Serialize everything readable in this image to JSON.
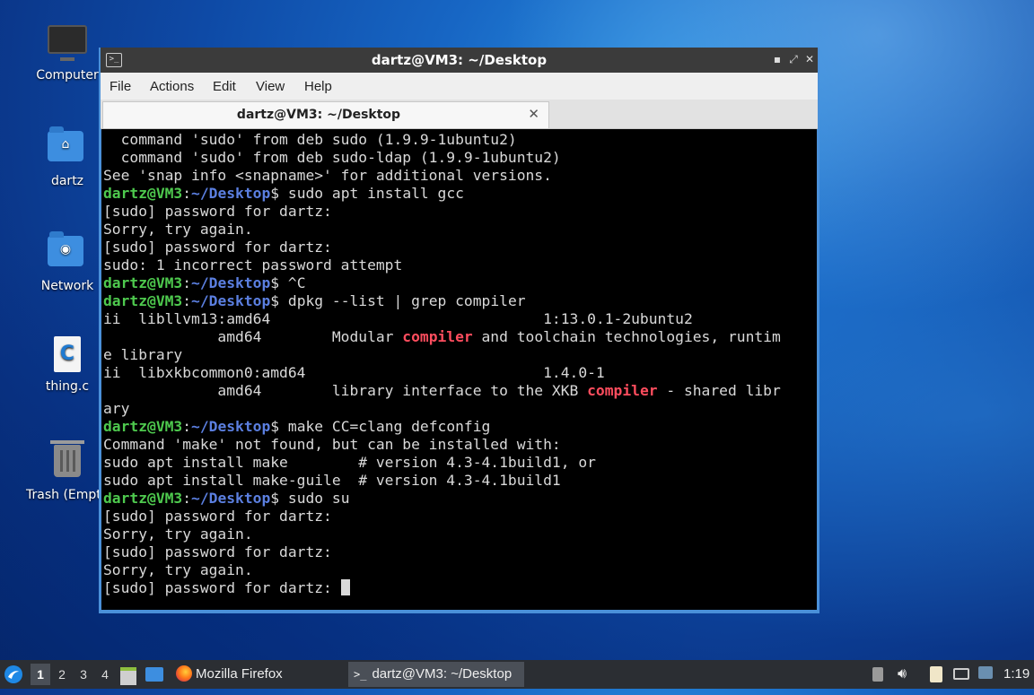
{
  "desktop": {
    "icons": [
      {
        "label": "Computer",
        "icon": "computer-icon"
      },
      {
        "label": "dartz",
        "icon": "home-folder-icon"
      },
      {
        "label": "Network",
        "icon": "network-folder-icon"
      },
      {
        "label": "thing.c",
        "icon": "c-source-file-icon"
      },
      {
        "label": "Trash (Empty)",
        "icon": "trash-icon"
      }
    ]
  },
  "window": {
    "title": "dartz@VM3: ~/Desktop",
    "menu": [
      "File",
      "Actions",
      "Edit",
      "View",
      "Help"
    ],
    "tab_label": "dartz@VM3: ~/Desktop",
    "controls": {
      "minimize": "▪",
      "maximize": "⤢",
      "close": "✕"
    }
  },
  "terminal": {
    "prompt_user": "dartz@VM3",
    "prompt_sep": ":",
    "prompt_path": "~/Desktop",
    "prompt_end": "$",
    "lines": [
      {
        "kind": "text",
        "text": "  command 'sudo' from deb sudo (1.9.9-1ubuntu2)"
      },
      {
        "kind": "text",
        "text": "  command 'sudo' from deb sudo-ldap (1.9.9-1ubuntu2)"
      },
      {
        "kind": "text",
        "text": "See 'snap info <snapname>' for additional versions."
      },
      {
        "kind": "prompt",
        "cmd": " sudo apt install gcc"
      },
      {
        "kind": "text",
        "text": "[sudo] password for dartz:"
      },
      {
        "kind": "text",
        "text": "Sorry, try again."
      },
      {
        "kind": "text",
        "text": "[sudo] password for dartz:"
      },
      {
        "kind": "text",
        "text": "sudo: 1 incorrect password attempt"
      },
      {
        "kind": "prompt",
        "cmd": " ^C"
      },
      {
        "kind": "prompt",
        "cmd": " dpkg --list | grep compiler"
      },
      {
        "kind": "text",
        "text": "ii  libllvm13:amd64                               1:13.0.1-2ubuntu2"
      },
      {
        "kind": "hl",
        "before": "             amd64        Modular ",
        "hl": "compiler",
        "after": " and toolchain technologies, runtim"
      },
      {
        "kind": "text",
        "text": "e library"
      },
      {
        "kind": "text",
        "text": "ii  libxkbcommon0:amd64                           1.4.0-1"
      },
      {
        "kind": "hl",
        "before": "             amd64        library interface to the XKB ",
        "hl": "compiler",
        "after": " - shared libr"
      },
      {
        "kind": "text",
        "text": "ary"
      },
      {
        "kind": "prompt",
        "cmd": " make CC=clang defconfig"
      },
      {
        "kind": "text",
        "text": "Command 'make' not found, but can be installed with:"
      },
      {
        "kind": "text",
        "text": "sudo apt install make        # version 4.3-4.1build1, or"
      },
      {
        "kind": "text",
        "text": "sudo apt install make-guile  # version 4.3-4.1build1"
      },
      {
        "kind": "prompt",
        "cmd": " sudo su"
      },
      {
        "kind": "text",
        "text": "[sudo] password for dartz:"
      },
      {
        "kind": "text",
        "text": "Sorry, try again."
      },
      {
        "kind": "text",
        "text": "[sudo] password for dartz:"
      },
      {
        "kind": "text",
        "text": "Sorry, try again."
      },
      {
        "kind": "cursor",
        "text": "[sudo] password for dartz: "
      }
    ]
  },
  "taskbar": {
    "workspaces": [
      "1",
      "2",
      "3",
      "4"
    ],
    "active_workspace": "1",
    "tasks": [
      {
        "label": "Mozilla Firefox",
        "icon": "firefox-icon",
        "active": false
      },
      {
        "label": "dartz@VM3: ~/Desktop",
        "icon": "terminal-icon",
        "active": true
      }
    ],
    "clock": "1:19"
  }
}
